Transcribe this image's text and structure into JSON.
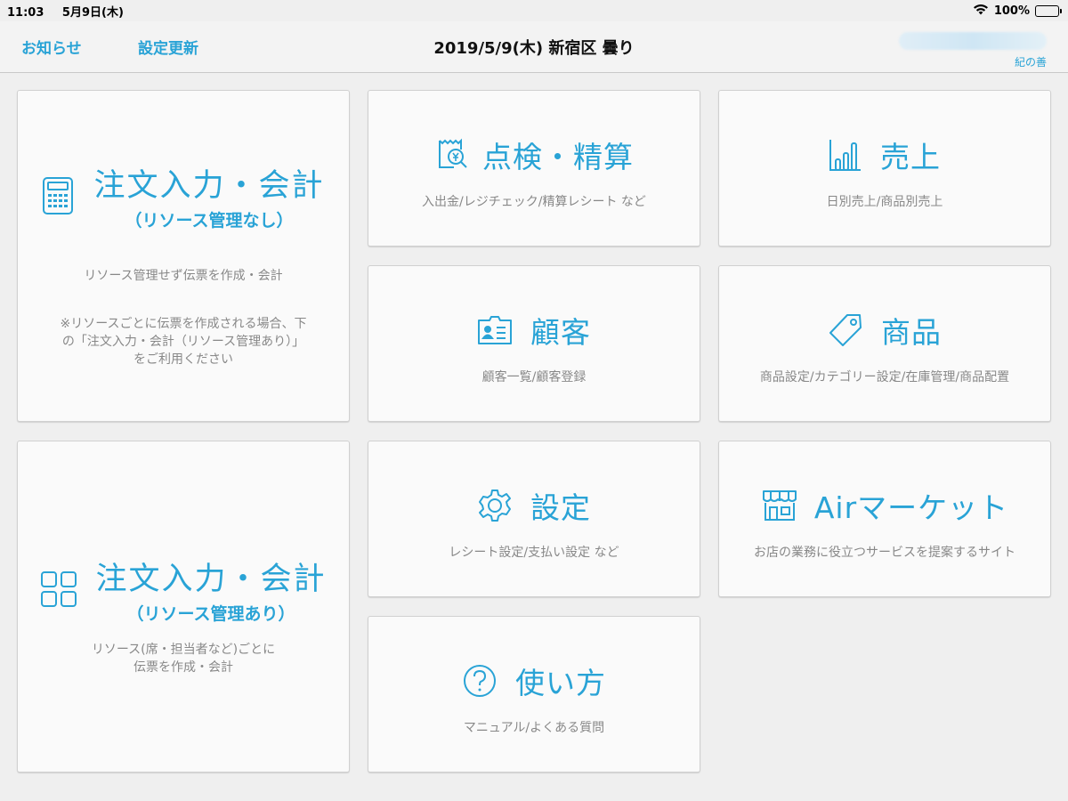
{
  "status_bar": {
    "time": "11:03",
    "date": "5月9日(木)",
    "battery": "100%"
  },
  "nav": {
    "notice_label": "お知らせ",
    "update_label": "設定更新",
    "title": "2019/5/9(木) 新宿区 曇り",
    "store_name": "紀の善"
  },
  "tiles": {
    "order_no_resource": {
      "title": "注文入力・会計",
      "subtitle": "（リソース管理なし）",
      "desc1": "リソース管理せず伝票を作成・会計",
      "note_line1": "※リソースごとに伝票を作成される場合、下",
      "note_line2": "の「注文入力・会計（リソース管理あり）」",
      "note_line3": "をご利用ください",
      "icon": "calculator-icon"
    },
    "order_resource": {
      "title": "注文入力・会計",
      "subtitle": "（リソース管理あり）",
      "desc_line1": "リソース(席・担当者など)ごとに",
      "desc_line2": "伝票を作成・会計",
      "icon": "grid-icon"
    },
    "check": {
      "title": "点検・精算",
      "desc": "入出金/レジチェック/精算レシート など",
      "icon": "receipt-yen-icon"
    },
    "sales": {
      "title": "売上",
      "desc": "日別売上/商品別売上",
      "icon": "bar-chart-icon"
    },
    "customer": {
      "title": "顧客",
      "desc": "顧客一覧/顧客登録",
      "icon": "id-card-icon"
    },
    "product": {
      "title": "商品",
      "desc": "商品設定/カテゴリー設定/在庫管理/商品配置",
      "icon": "tag-icon"
    },
    "settings": {
      "title": "設定",
      "desc": "レシート設定/支払い設定 など",
      "icon": "gear-icon"
    },
    "market": {
      "title": "Airマーケット",
      "desc": "お店の業務に役立つサービスを提案するサイト",
      "icon": "storefront-icon"
    },
    "help": {
      "title": "使い方",
      "desc": "マニュアル/よくある質問",
      "icon": "question-icon"
    }
  },
  "colors": {
    "accent": "#29a3d6",
    "background": "#efefef",
    "tile": "#fafafa",
    "muted_text": "#888888"
  }
}
